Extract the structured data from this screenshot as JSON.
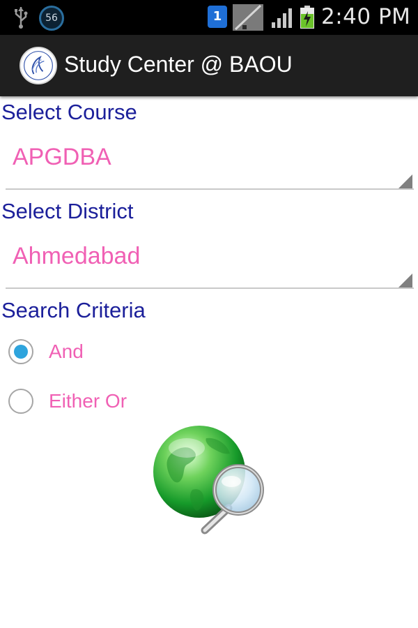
{
  "status_bar": {
    "badge": "56",
    "notification": "1",
    "time": "2:40 PM"
  },
  "app": {
    "title": "Study Center @ BAOU"
  },
  "course": {
    "label": "Select Course",
    "selected": "APGDBA"
  },
  "district": {
    "label": "Select District",
    "selected": "Ahmedabad"
  },
  "criteria": {
    "label": "Search Criteria",
    "options": [
      {
        "label": "And",
        "checked": true
      },
      {
        "label": "Either Or",
        "checked": false
      }
    ]
  },
  "icons": {
    "usb": "usb-icon",
    "badge": "update-badge-icon",
    "notification": "notification-icon",
    "no_sim": "no-signal-icon",
    "signal": "signal-icon",
    "battery": "battery-charging-icon",
    "logo": "app-logo-icon",
    "search": "globe-search-icon"
  },
  "colors": {
    "label_blue": "#1b1f9a",
    "value_pink": "#f060b4",
    "radio_accent": "#2ea4dd",
    "action_bar": "#1f1f1f"
  }
}
